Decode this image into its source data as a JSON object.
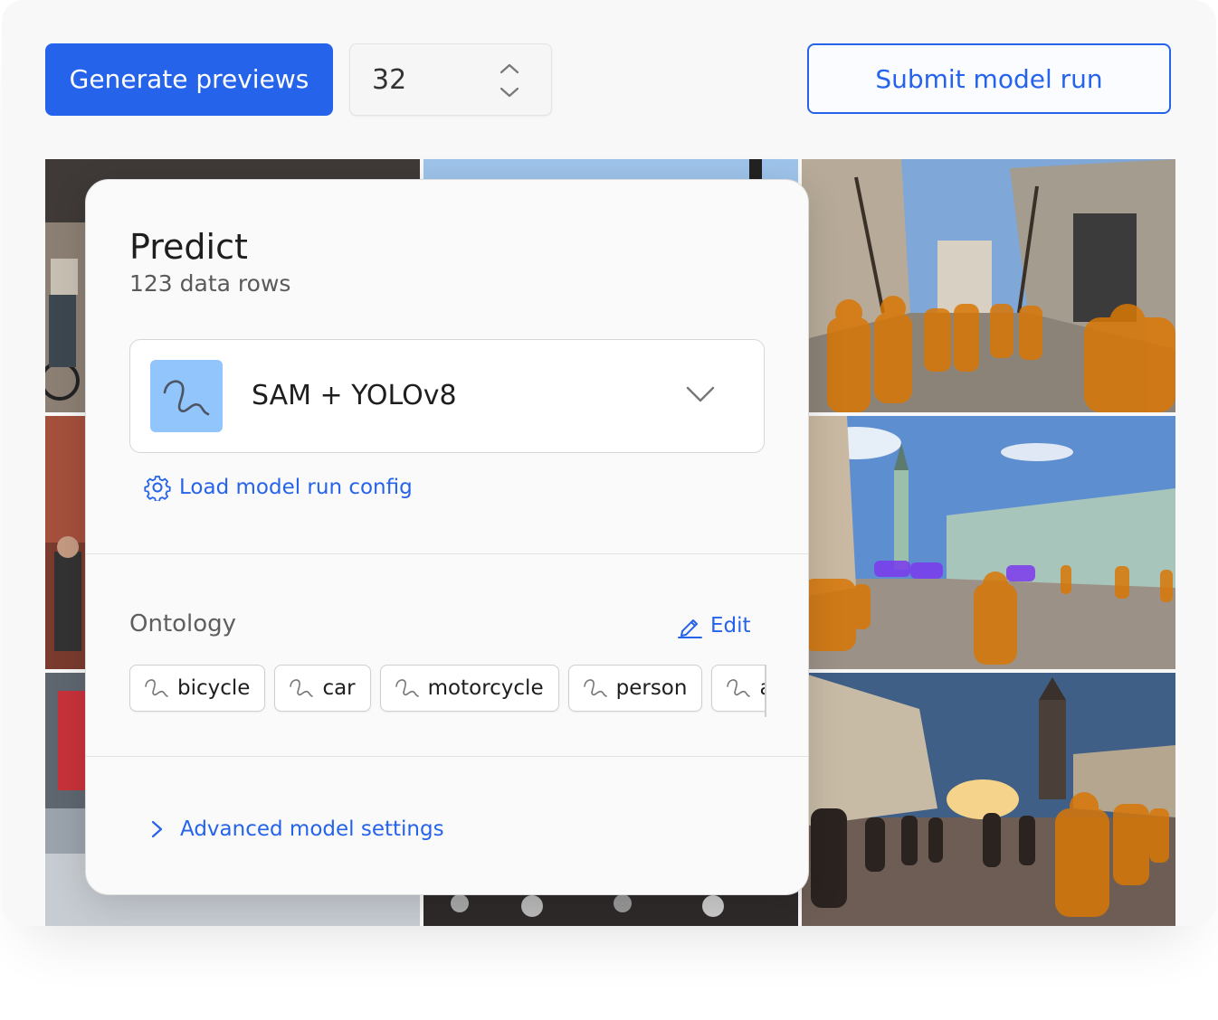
{
  "toolbar": {
    "generate_label": "Generate previews",
    "preview_count": "32",
    "submit_label": "Submit model run"
  },
  "panel": {
    "title": "Predict",
    "subtitle": "123 data rows",
    "model": {
      "name": "SAM + YOLOv8",
      "icon": "model-scribble-icon"
    },
    "config_link": "Load model run config",
    "ontology": {
      "label": "Ontology",
      "edit_label": "Edit",
      "classes": [
        "bicycle",
        "car",
        "motorcycle",
        "person",
        "a"
      ]
    },
    "advanced_label": "Advanced model settings"
  },
  "colors": {
    "accent": "#2563eb",
    "model_icon_bg": "#93c5fd",
    "person_mask": "#d97706",
    "car_mask": "#7c3aed"
  },
  "preview_grid": {
    "columns": 3,
    "rows": 3,
    "mask_classes_visible": [
      "person",
      "car"
    ]
  }
}
